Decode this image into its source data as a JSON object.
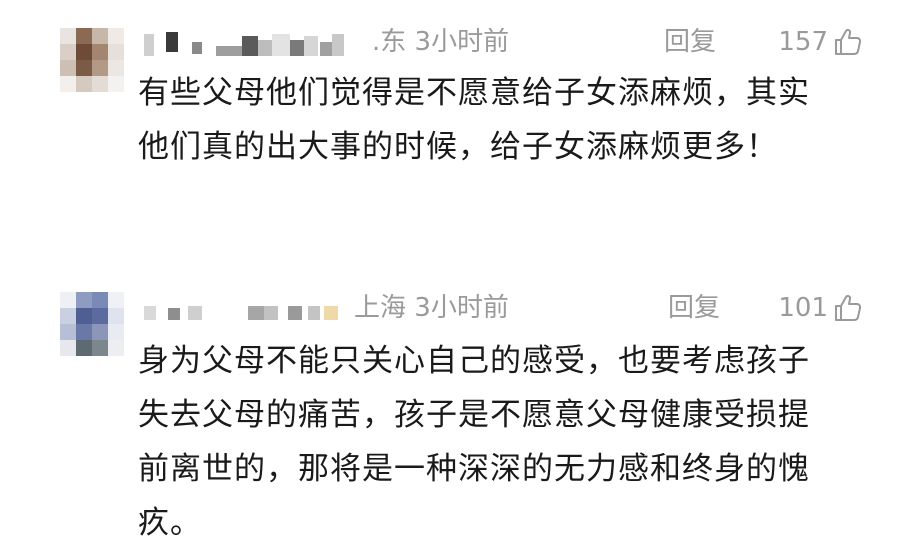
{
  "comments": [
    {
      "location": ".东",
      "time": "3小时前",
      "reply_label": "回复",
      "likes": "157",
      "text": "有些父母他们觉得是不愿意给子女添麻烦，其实他们真的出大事的时候，给子女添麻烦更多！",
      "avatar_colors": [
        "#e9e4df",
        "#8a6a52",
        "#c7b7a8",
        "#efeae6",
        "#d9cfc6",
        "#6e4b38",
        "#a48670",
        "#e6e0da",
        "#cdbfb3",
        "#7b5a46",
        "#b29a86",
        "#ece7e2",
        "#f2efec",
        "#d6cac0",
        "#e3dcd5",
        "#f4f2f0"
      ]
    },
    {
      "location": "上海",
      "time": "3小时前",
      "reply_label": "回复",
      "likes": "101",
      "text": "身为父母不能只关心自己的感受，也要考虑孩子失去父母的痛苦，孩子是不愿意父母健康受损提前离世的，那将是一种深深的无力感和终身的愧疚。",
      "avatar_colors": [
        "#eef0f5",
        "#8e9cc2",
        "#7a8ab8",
        "#f0f1f6",
        "#c9d0e2",
        "#4f5f94",
        "#5b6ba0",
        "#dfe3ee",
        "#b7bfd6",
        "#6a78a8",
        "#8c96b8",
        "#e8ebf2",
        "#e6e8ee",
        "#5d6a72",
        "#7c868d",
        "#eceef2"
      ]
    }
  ],
  "icons": {
    "like": "thumbs-up-icon"
  },
  "colors": {
    "meta_gray": "#9a9a9a",
    "text": "#1a1a1a"
  }
}
